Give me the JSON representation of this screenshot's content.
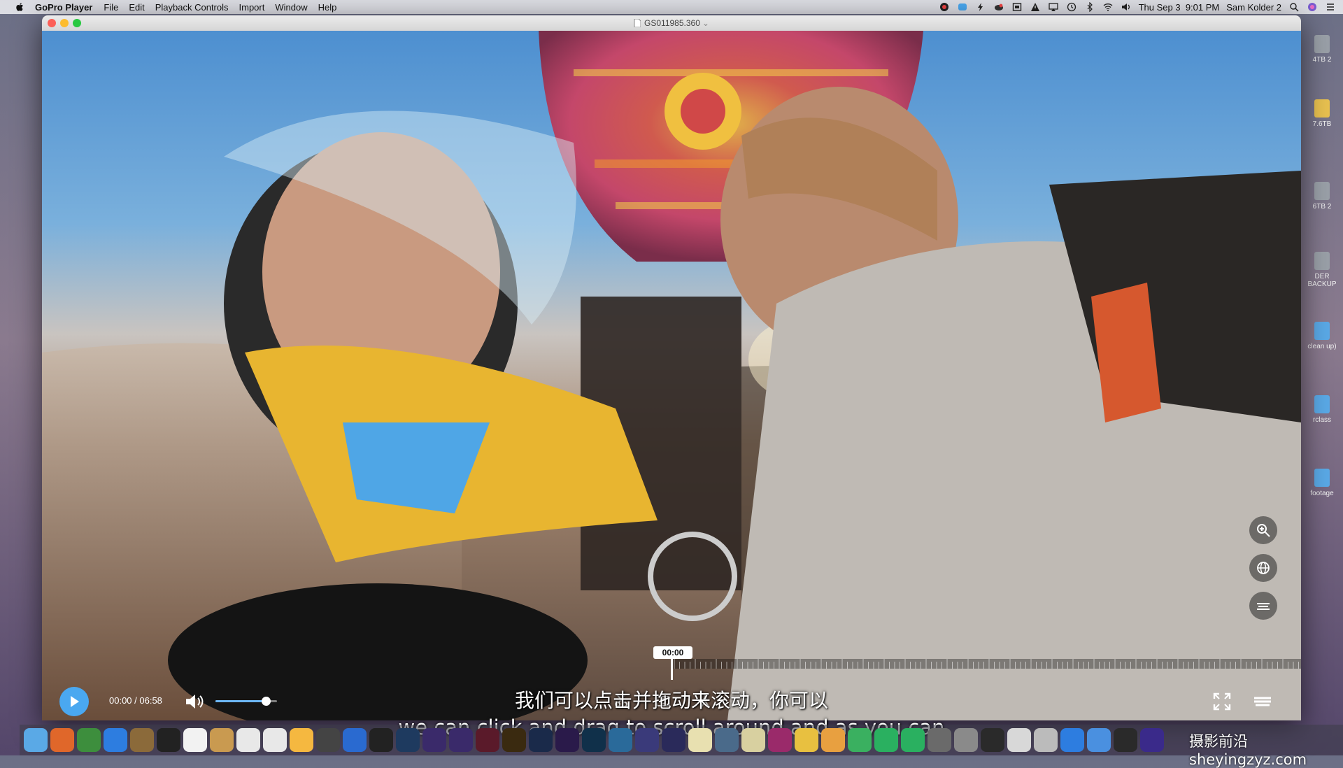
{
  "menubar": {
    "app_name": "GoPro Player",
    "items": [
      "File",
      "Edit",
      "Playback Controls",
      "Import",
      "Window",
      "Help"
    ],
    "clock": "Thu Sep 3  9:01 PM",
    "user": "Sam Kolder 2"
  },
  "window": {
    "title": "GS011985.360",
    "title_chevron": "⌄"
  },
  "player": {
    "current_time": "00:00",
    "duration": "06:58",
    "time_readout": "00:00 / 06:58",
    "timeline_tip": "00:00",
    "volume_level": 0.82,
    "accent": "#4aa8f0"
  },
  "desktop_drives": [
    {
      "label": "4TB 2"
    },
    {
      "label": "7.6TB"
    },
    {
      "label": "6TB 2"
    },
    {
      "label": "DER BACKUP"
    },
    {
      "label": "clean up)"
    },
    {
      "label": "rclass"
    },
    {
      "label": "footage"
    }
  ],
  "subtitles": {
    "chinese": "我们可以点击并拖动来滚动，你可以",
    "english": "we can click and drag to scroll around and as you can"
  },
  "watermark": "摄影前沿 sheyingzyz.com",
  "icons": {
    "zoom": "zoom-in-icon",
    "reframe": "reframe-globe-icon",
    "horizon": "horizon-level-icon",
    "fullscreen": "fullscreen-icon",
    "trim": "scissors-icon",
    "frame_grab": "frame-grab-icon",
    "tag": "highlight-tag-icon"
  }
}
